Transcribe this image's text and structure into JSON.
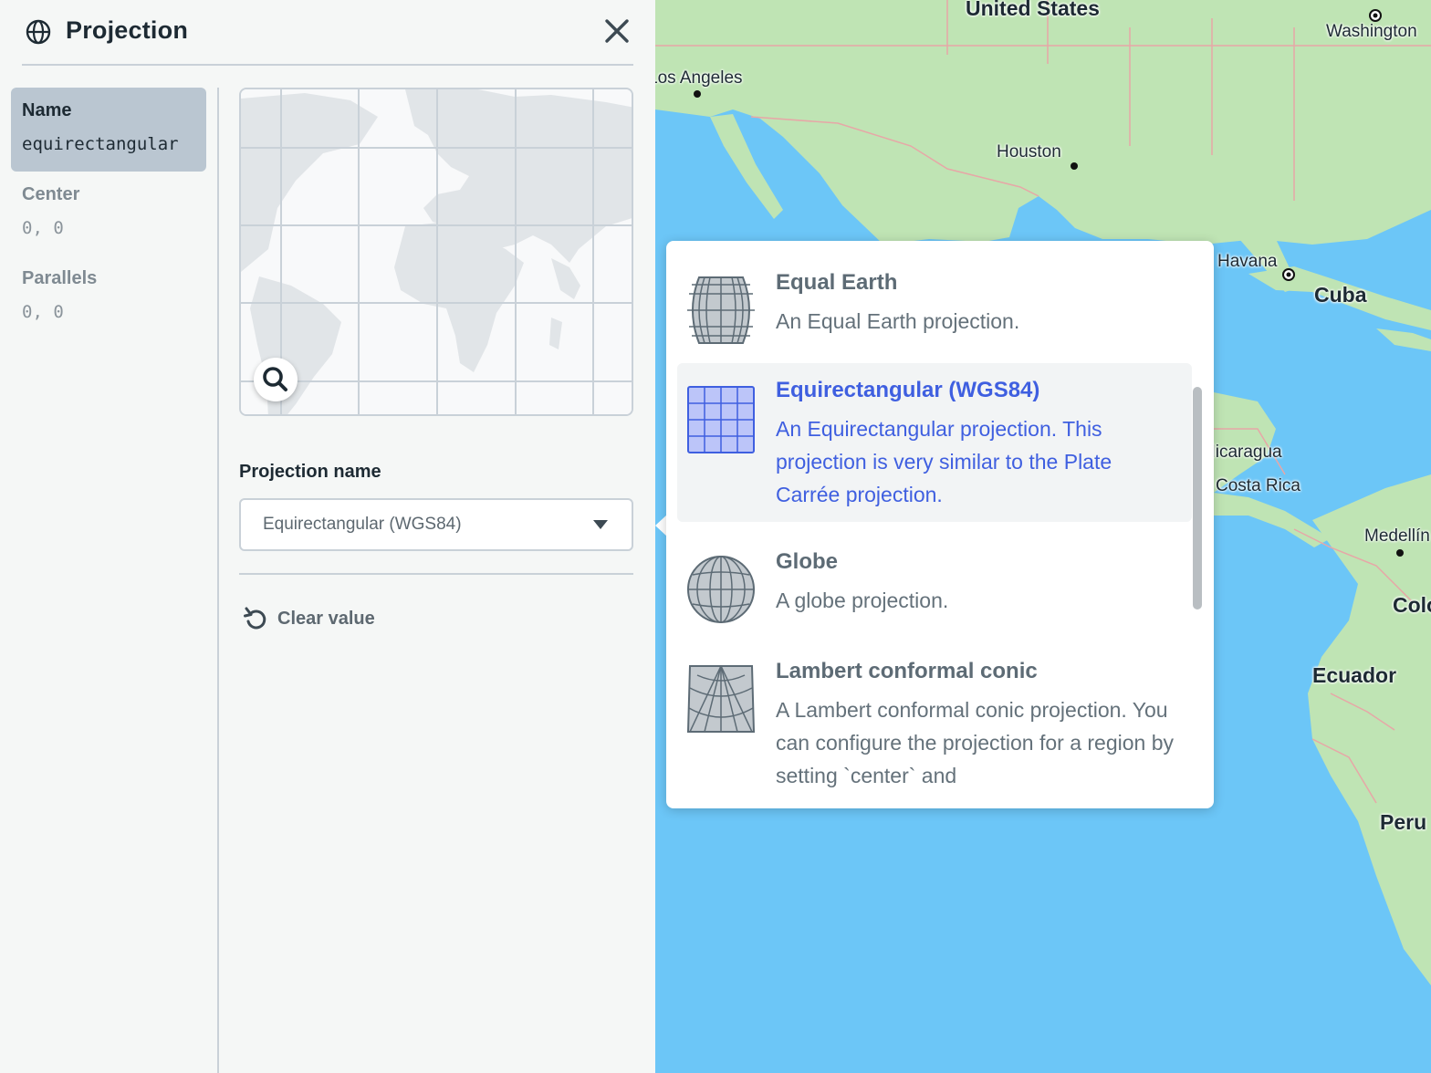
{
  "panel": {
    "title": "Projection",
    "close_icon": "close-icon",
    "properties": [
      {
        "label": "Name",
        "value": "equirectangular"
      },
      {
        "label": "Center",
        "value": "0, 0"
      },
      {
        "label": "Parallels",
        "value": "0, 0"
      }
    ],
    "field_label": "Projection name",
    "select_value": "Equirectangular (WGS84)",
    "clear_label": "Clear value"
  },
  "map_labels": [
    {
      "text": "United States"
    },
    {
      "text": "Washington"
    },
    {
      "text": "Los Angeles"
    },
    {
      "text": "Houston"
    },
    {
      "text": "Havana"
    },
    {
      "text": "Cuba"
    },
    {
      "text": "Nicaragua"
    },
    {
      "text": "Costa Rica"
    },
    {
      "text": "Medellín"
    },
    {
      "text": "Colombia"
    },
    {
      "text": "Ecuador"
    },
    {
      "text": "Peru"
    }
  ],
  "dropdown": {
    "options": [
      {
        "title": "Equal Earth",
        "desc": "An Equal Earth projection."
      },
      {
        "title": "Equirectangular (WGS84)",
        "desc": "An Equirectangular projection. This projection is very similar to the Plate Carrée projection."
      },
      {
        "title": "Globe",
        "desc": "A globe projection."
      },
      {
        "title": "Lambert conformal conic",
        "desc": "A Lambert conformal conic projection. You can configure the projection for a region by setting `center` and"
      }
    ]
  },
  "colors": {
    "accent": "#3f5fe0",
    "land": "#bfe4b4",
    "water": "#6cc6f7",
    "selected_bg": "#bac6d1"
  }
}
